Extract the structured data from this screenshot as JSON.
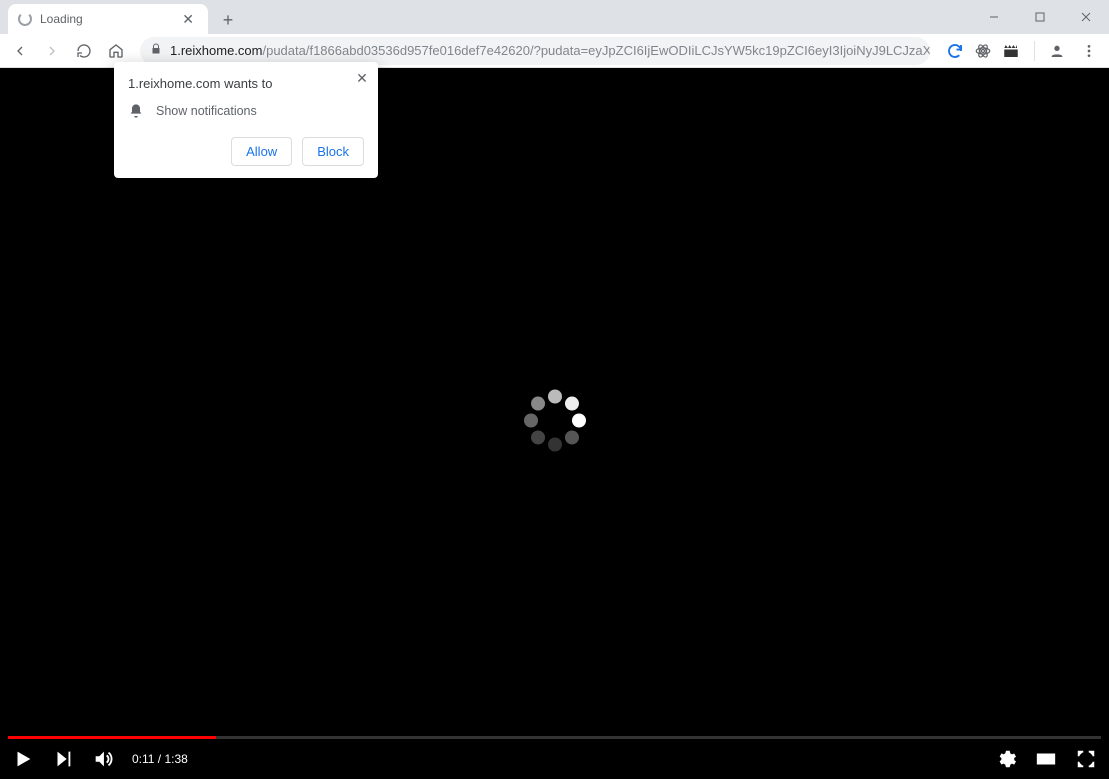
{
  "window": {
    "tab_title": "Loading"
  },
  "address": {
    "domain": "1.reixhome.com",
    "path": "/pudata/f1866abd03536d957fe016def7e42620/?pudata=eyJpZCI6IjEwODIiLCJsYW5kc19pZCI6eyI3IjoiNyJ9LCJzaXRlX2lkIjoiMTk3NCI..."
  },
  "permission": {
    "title": "1.reixhome.com wants to",
    "capability": "Show notifications",
    "allow": "Allow",
    "block": "Block"
  },
  "video": {
    "current": "0:11",
    "duration": "1:38",
    "progress_pct": 19
  }
}
